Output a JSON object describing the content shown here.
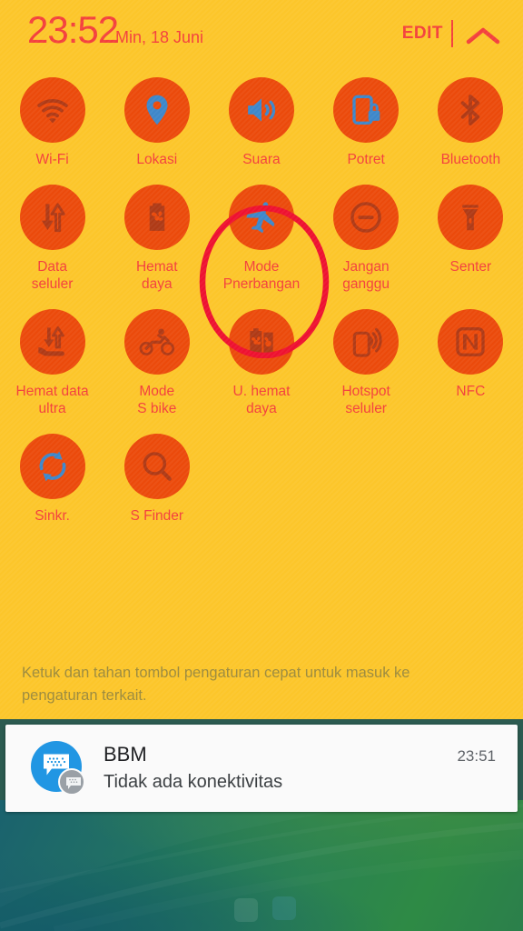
{
  "header": {
    "time": "23:52",
    "date": "Min, 18 Juni",
    "edit_label": "EDIT",
    "collapse_icon": "chevron-up-icon"
  },
  "colors": {
    "panel_bg": "#FCC62A",
    "toggle_circle": "#EB4A0B",
    "label_text": "#F3403C",
    "icon_on": "#3E87CA",
    "icon_off": "#AF3A16",
    "annotation": "#EE1130",
    "hint_text": "#9C8A3D",
    "notification_bg": "#FAFAFA",
    "bbm_blue": "#2196E3"
  },
  "quick_settings": {
    "rows": [
      [
        {
          "label": "Wi-Fi",
          "icon": "wifi-icon",
          "state": "off"
        },
        {
          "label": "Lokasi",
          "icon": "location-pin-icon",
          "state": "on"
        },
        {
          "label": "Suara",
          "icon": "sound-speaker-icon",
          "state": "on"
        },
        {
          "label": "Potret",
          "icon": "rotation-lock-icon",
          "state": "on"
        },
        {
          "label": "Bluetooth",
          "icon": "bluetooth-icon",
          "state": "off"
        }
      ],
      [
        {
          "label": "Data\nseluler",
          "icon": "mobile-data-arrows-icon",
          "state": "off"
        },
        {
          "label": "Hemat\ndaya",
          "icon": "power-saving-battery-icon",
          "state": "off"
        },
        {
          "label": "Mode\nPnerbangan",
          "icon": "airplane-icon",
          "state": "on",
          "highlighted": true
        },
        {
          "label": "Jangan\nganggu",
          "icon": "do-not-disturb-icon",
          "state": "off"
        },
        {
          "label": "Senter",
          "icon": "flashlight-icon",
          "state": "off"
        }
      ],
      [
        {
          "label": "Hemat data\nultra",
          "icon": "ultra-data-saving-icon",
          "state": "off"
        },
        {
          "label": "Mode\nS bike",
          "icon": "motorcycle-icon",
          "state": "off"
        },
        {
          "label": "U. hemat\ndaya",
          "icon": "ultra-power-saving-icon",
          "state": "off"
        },
        {
          "label": "Hotspot\nseluler",
          "icon": "mobile-hotspot-icon",
          "state": "off"
        },
        {
          "label": "NFC",
          "icon": "nfc-icon",
          "state": "off"
        }
      ],
      [
        {
          "label": "Sinkr.",
          "icon": "sync-icon",
          "state": "on"
        },
        {
          "label": "S Finder",
          "icon": "search-magnifier-icon",
          "state": "off"
        }
      ]
    ]
  },
  "hint": {
    "text": "Ketuk dan tahan tombol pengaturan cepat untuk masuk ke pengaturan terkait."
  },
  "notification": {
    "app_icon": "bbm-app-icon",
    "badge_icon": "bbm-badge-icon",
    "title": "BBM",
    "body": "Tidak ada konektivitas",
    "time": "23:51"
  },
  "annotation": {
    "shape": "red-ellipse-highlight",
    "targets": "Mode Pnerbangan"
  }
}
